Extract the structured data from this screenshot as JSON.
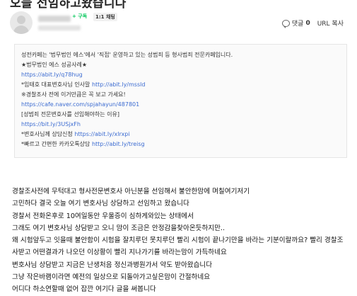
{
  "post": {
    "title": "오늘 선임하고왔습니다"
  },
  "author": {
    "subscribe_label": "+ 구독",
    "chat_label": "1:1 채팅"
  },
  "actions": {
    "comment_label": "댓글",
    "comment_count": "0",
    "url_copy_label": "URL 복사"
  },
  "notice": {
    "lines": [
      {
        "text": "성전카페는 '법무법인 에스'에서 '직접' 운영하고 있는 성범죄 등 형사범죄 전문카페입니다.",
        "link": ""
      },
      {
        "text": "★법무법인 에스 성공사례★",
        "link": ""
      },
      {
        "text": "",
        "link": "https://abit.ly/q78hug"
      },
      {
        "text": "*임태호 대표변호사님 인사말 ",
        "link": "http://abit.ly/mssld"
      },
      {
        "text": "※경찰조사 전에 이거만큼은 꼭 보고 가세요!",
        "link": ""
      },
      {
        "text": "",
        "link": "https://cafe.naver.com/spjahayun/487801"
      },
      {
        "text": "[성범죄 전문변호사를 선임해야하는 이유]",
        "link": ""
      },
      {
        "text": "",
        "link": "https://bit.ly/3USjxFh"
      },
      {
        "text": "*변호사님께 상담신청 ",
        "link": "https://abit.ly/xlrxpi"
      },
      {
        "text": "*빠르고 간편한 카카오톡상담 ",
        "link": "http://abit.ly/treisg"
      }
    ]
  },
  "content": {
    "lines": [
      "경찰조사전에 무턱대고 형사전문변호사 아닌분을 선임해서 불안한맘에 며칠여기저기",
      "고민하다 결국 오늘 여기 변호사님 상담하고 선임하고 왔습니다",
      "경찰서 전화온후로 10여일동안 우울증이 심하게와있는 상태에서",
      "그래도 여기 변호사님 상담받고 오니 맘이 조금은 안정감을찾아온듯하지만..",
      "왜 시험앞두고 잇을때 불안함이 시험을 잘치루던 못치루던 빨리 시험이 끝나기만을 바라는 기분이랄까요? 빨리 경찰조",
      "사받고 어떤결과가 나오던 이상황이 빨리 지나가기를 바라는맘이 가득하네요",
      "변호사님 상담받고 지금은 난생처음 정신과병원가서 약도 받아왔습니다",
      "그냥 작은바램이라면 예전의 일상으로 되돌아가고싶은맘이 간절하네요",
      "어디다 하소연할때 없어 잡깐 여기다 글을 써봅니다"
    ]
  },
  "colors": {
    "link": "#3b6bd1",
    "subscribe": "#03c75a",
    "box_bg": "#fafafa"
  }
}
